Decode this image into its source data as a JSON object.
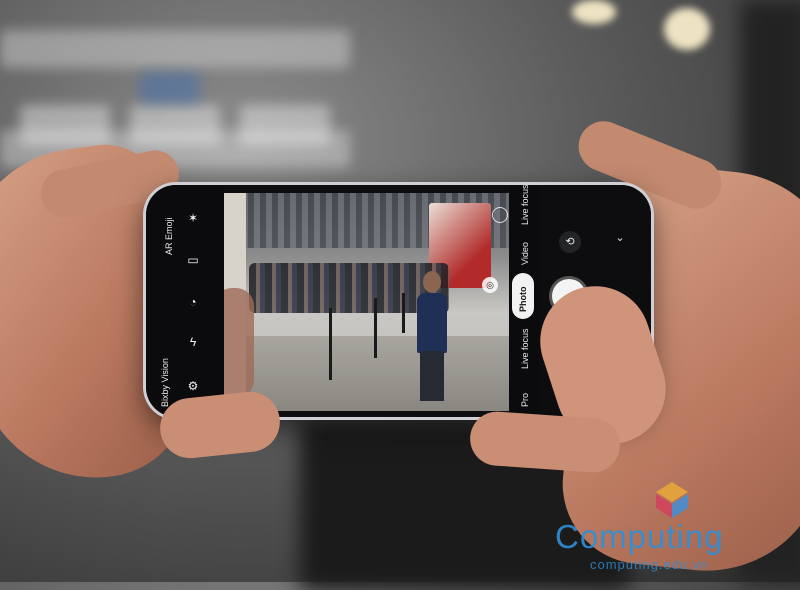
{
  "camera": {
    "left_modes": [
      "AR Emoji",
      "Bixby Vision"
    ],
    "modes": [
      "Pro",
      "Live focus",
      "Photo",
      "Video",
      "Live focus"
    ],
    "active_mode": "Photo",
    "icons": {
      "flash": "flash-icon",
      "ratio": "aspect-ratio-icon",
      "timer": "timer-icon",
      "effects": "magic-wand-icon",
      "settings": "gear-icon",
      "switch_camera": "switch-camera-icon",
      "expand": "chevron-down-icon",
      "gallery": "gallery-icon"
    }
  },
  "watermark": {
    "brand": "Computing",
    "url": "computing.edu.vn"
  },
  "colors": {
    "brand_blue": "#2f8fd8",
    "gallery_red": "#e8344f"
  }
}
